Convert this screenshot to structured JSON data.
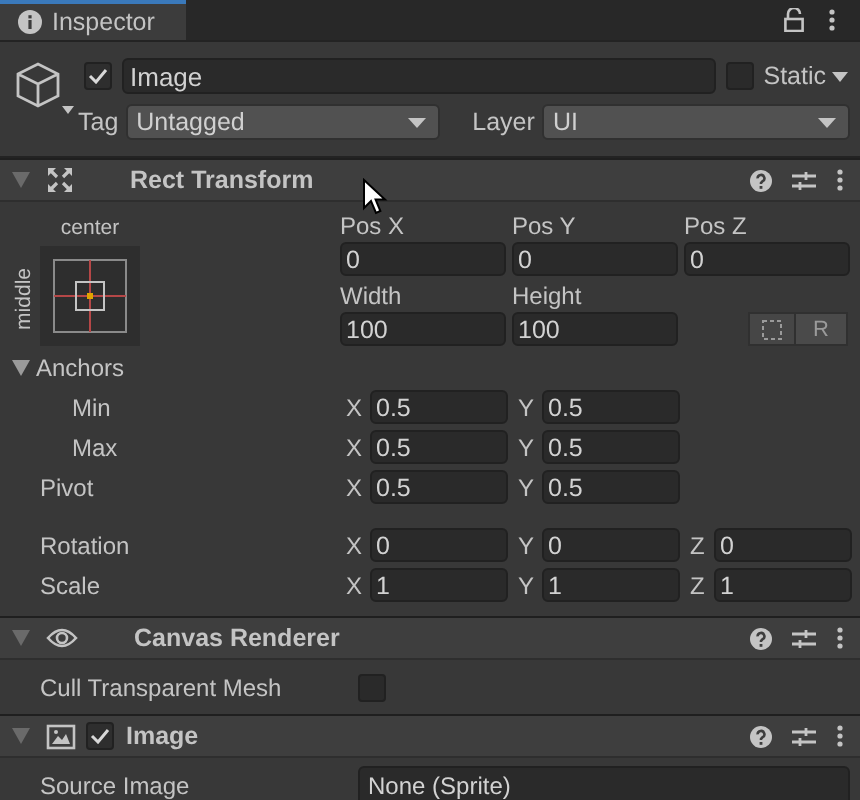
{
  "tab": {
    "label": "Inspector",
    "selected": true
  },
  "object": {
    "active": true,
    "name": "Image",
    "static": false,
    "static_label": "Static",
    "tag_label": "Tag",
    "tag": "Untagged",
    "layer_label": "Layer",
    "layer": "UI"
  },
  "components": [
    {
      "kind": "rect_transform",
      "title": "Rect Transform",
      "expanded": true,
      "anchor_horizontal": "center",
      "anchor_vertical": "middle",
      "pos": [
        {
          "label": "Pos X",
          "value": "0"
        },
        {
          "label": "Pos Y",
          "value": "0"
        },
        {
          "label": "Pos Z",
          "value": "0"
        }
      ],
      "size": [
        {
          "label": "Width",
          "value": "100"
        },
        {
          "label": "Height",
          "value": "100"
        }
      ],
      "raw_button": "R",
      "anchors": {
        "label": "Anchors",
        "expanded": true,
        "children": [
          {
            "label": "Min",
            "fields": [
              {
                "axis": "X",
                "value": "0.5"
              },
              {
                "axis": "Y",
                "value": "0.5"
              }
            ]
          },
          {
            "label": "Max",
            "fields": [
              {
                "axis": "X",
                "value": "0.5"
              },
              {
                "axis": "Y",
                "value": "0.5"
              }
            ]
          }
        ]
      },
      "pivot": {
        "label": "Pivot",
        "fields": [
          {
            "axis": "X",
            "value": "0.5"
          },
          {
            "axis": "Y",
            "value": "0.5"
          }
        ]
      },
      "transform_rows": [
        {
          "label": "Rotation",
          "fields": [
            {
              "axis": "X",
              "value": "0"
            },
            {
              "axis": "Y",
              "value": "0"
            },
            {
              "axis": "Z",
              "value": "0"
            }
          ]
        },
        {
          "label": "Scale",
          "fields": [
            {
              "axis": "X",
              "value": "1"
            },
            {
              "axis": "Y",
              "value": "1"
            },
            {
              "axis": "Z",
              "value": "1"
            }
          ]
        }
      ]
    },
    {
      "kind": "canvas_renderer",
      "title": "Canvas Renderer",
      "expanded": true,
      "toggles": [
        {
          "label": "Cull Transparent Mesh",
          "checked": false
        }
      ]
    },
    {
      "kind": "image",
      "title": "Image",
      "expanded": true,
      "enabled": true,
      "fields": [
        {
          "label": "Source Image",
          "value": "None (Sprite)"
        }
      ]
    }
  ]
}
